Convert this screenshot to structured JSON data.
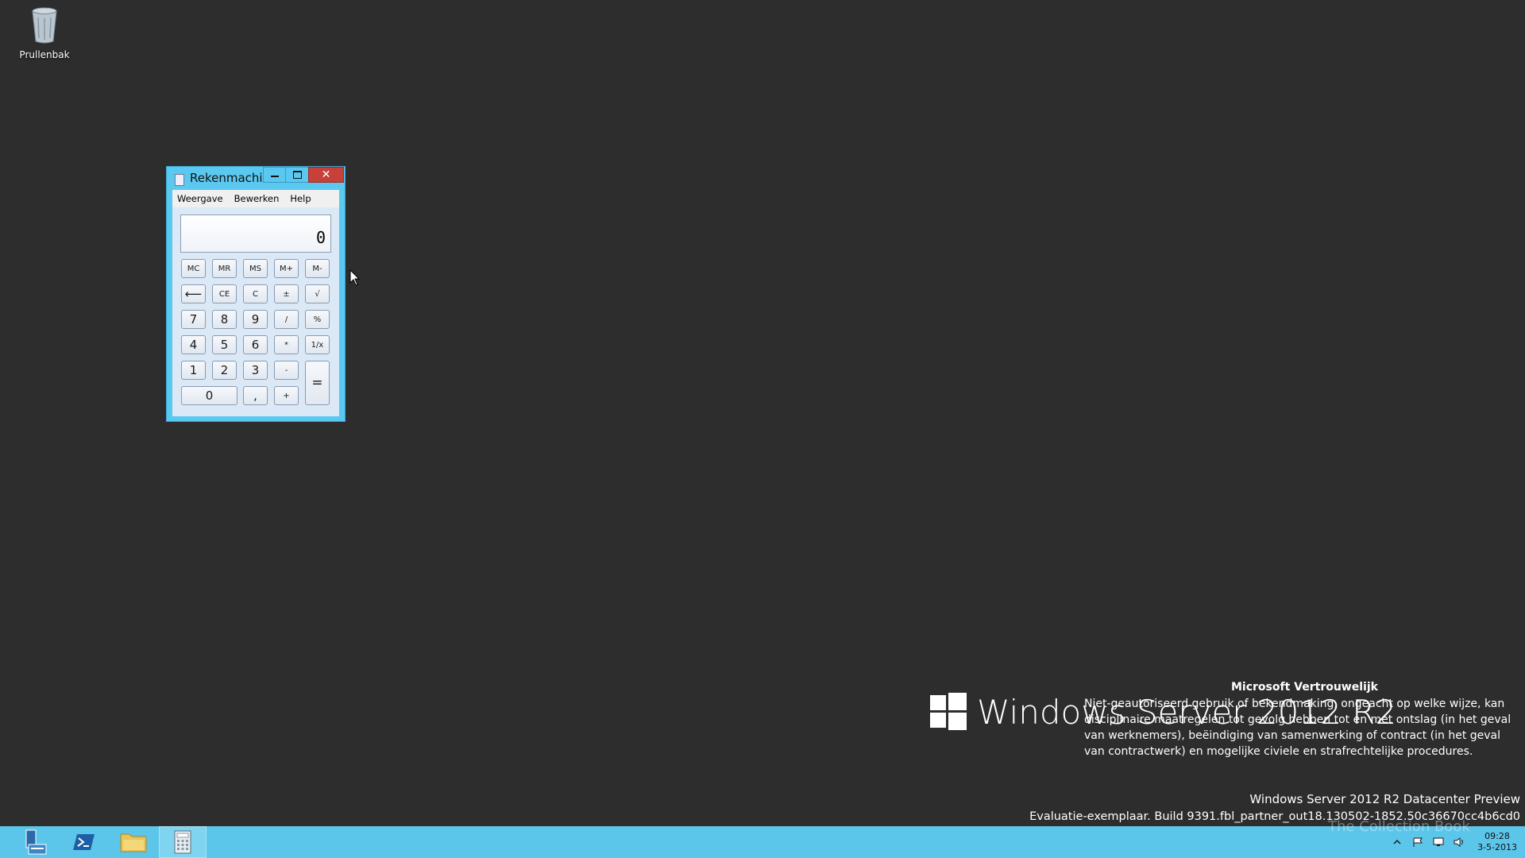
{
  "desktop": {
    "recycle_bin_label": "Prullenbak"
  },
  "calculator": {
    "title": "Rekenmachi...",
    "menu": [
      "Weergave",
      "Bewerken",
      "Help"
    ],
    "display_value": "0",
    "keys": {
      "mc": "MC",
      "mr": "MR",
      "ms": "MS",
      "mplus": "M+",
      "mminus": "M-",
      "back": "⟵",
      "ce": "CE",
      "c": "C",
      "neg": "±",
      "sqrt": "√",
      "k7": "7",
      "k8": "8",
      "k9": "9",
      "div": "/",
      "pct": "%",
      "k4": "4",
      "k5": "5",
      "k6": "6",
      "mul": "*",
      "recip": "1/x",
      "k1": "1",
      "k2": "2",
      "k3": "3",
      "sub": "-",
      "k0": "0",
      "dec": ",",
      "add": "+",
      "eq": "="
    },
    "window_buttons": {
      "close": "✕"
    }
  },
  "branding": {
    "product": "Windows Server 2012 R2",
    "confidential_title": "Microsoft Vertrouwelijk",
    "confidential_body": "Niet-geautoriseerd gebruik of bekendmaking, ongeacht op welke wijze, kan disciplinaire maatregelen tot gevolg hebben tot en met ontslag (in het geval van werknemers), beëindiging van samenwerking of contract (in het geval van contractwerk) en mogelijke civiele en strafrechtelijke procedures.",
    "edition": "Windows Server 2012 R2 Datacenter Preview",
    "build": "Evaluatie-exemplaar. Build 9391.fbl_partner_out18.130502-1852.50c36670cc4b6cd0",
    "watermark": "The Collection Book"
  },
  "taskbar": {
    "items": [
      "server-manager",
      "powershell",
      "file-explorer",
      "calculator"
    ],
    "time": "09:28",
    "date": "3-5-2013"
  },
  "colors": {
    "desktop": "#2d2d2d",
    "taskbar": "#5cc6ea",
    "window_frame": "#5ac8ef",
    "close_button": "#c7403a"
  }
}
